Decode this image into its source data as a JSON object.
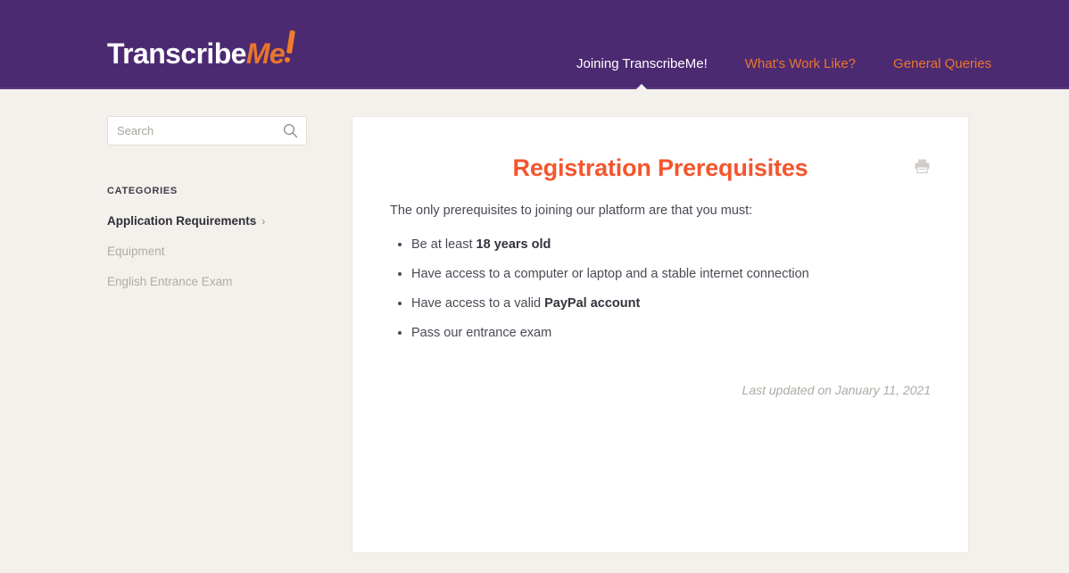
{
  "brand": {
    "logo_part1": "Transcribe",
    "logo_part2": "Me",
    "logo_accent_color": "#e8762c",
    "header_color": "#4c2a72"
  },
  "nav": {
    "items": [
      {
        "label": "Joining TranscribeMe!",
        "active": true
      },
      {
        "label": "What's Work Like?",
        "active": false
      },
      {
        "label": "General Queries",
        "active": false
      }
    ]
  },
  "sidebar": {
    "search": {
      "placeholder": "Search",
      "value": "",
      "icon": "search-icon"
    },
    "categories_heading": "CATEGORIES",
    "categories": [
      {
        "label": "Application Requirements",
        "active": true,
        "chevron": "›"
      },
      {
        "label": "Equipment",
        "active": false
      },
      {
        "label": "English Entrance Exam",
        "active": false
      }
    ]
  },
  "article": {
    "title": "Registration Prerequisites",
    "title_color": "#f4552e",
    "print_icon": "printer-icon",
    "intro": "The only prerequisites to joining our platform are that you must:",
    "requirements": [
      {
        "pre": "Be at least ",
        "bold": "18 years old",
        "post": ""
      },
      {
        "pre": "Have access to a computer or laptop and a stable internet connection",
        "bold": "",
        "post": ""
      },
      {
        "pre": "Have access to a valid ",
        "bold": "PayPal account",
        "post": ""
      },
      {
        "pre": "Pass our entrance exam",
        "bold": "",
        "post": ""
      }
    ],
    "last_updated": "Last updated on January 11, 2021"
  }
}
